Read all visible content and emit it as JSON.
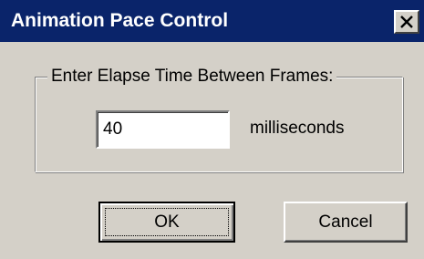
{
  "window": {
    "title": "Animation Pace Control",
    "close_icon": "close-icon"
  },
  "group": {
    "label": "Enter Elapse Time Between Frames:"
  },
  "field": {
    "value": "40",
    "units": "milliseconds"
  },
  "buttons": {
    "ok_label": "OK",
    "cancel_label": "Cancel"
  },
  "colors": {
    "titlebar": "#0a246a",
    "face": "#d4d0c8"
  }
}
